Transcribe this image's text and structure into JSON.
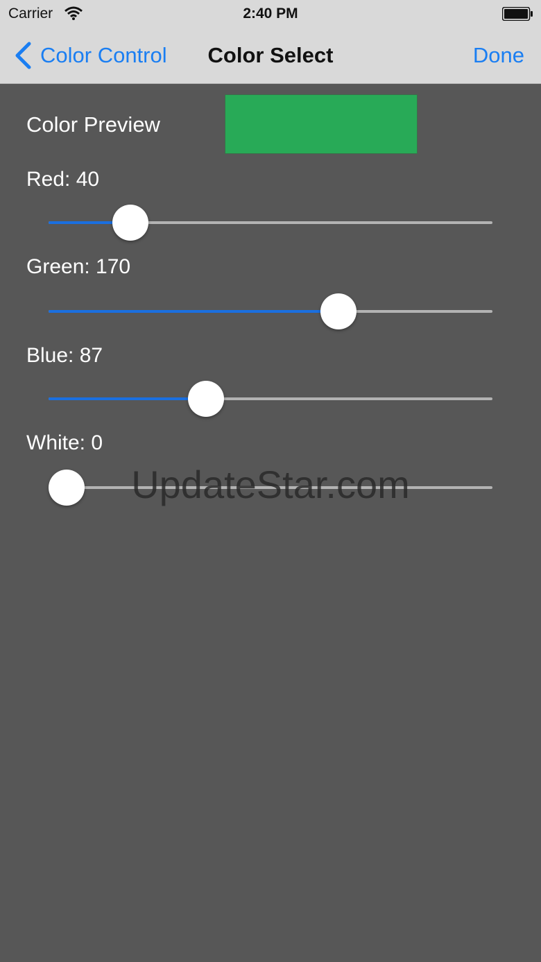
{
  "status_bar": {
    "carrier": "Carrier",
    "time": "2:40 PM"
  },
  "nav": {
    "back_label": "Color Control",
    "title": "Color Select",
    "done_label": "Done"
  },
  "preview": {
    "label": "Color Preview",
    "color": "#28aa57"
  },
  "sliders": [
    {
      "label": "Red: 40",
      "value": 40,
      "max": 255
    },
    {
      "label": "Green: 170",
      "value": 170,
      "max": 255
    },
    {
      "label": "Blue: 87",
      "value": 87,
      "max": 255
    },
    {
      "label": "White: 0",
      "value": 0,
      "max": 255
    }
  ],
  "colors": {
    "accent": "#1a7ef2",
    "slider_fill": "#1a6fe0",
    "background": "#575757"
  },
  "watermark": "UpdateStar.com"
}
